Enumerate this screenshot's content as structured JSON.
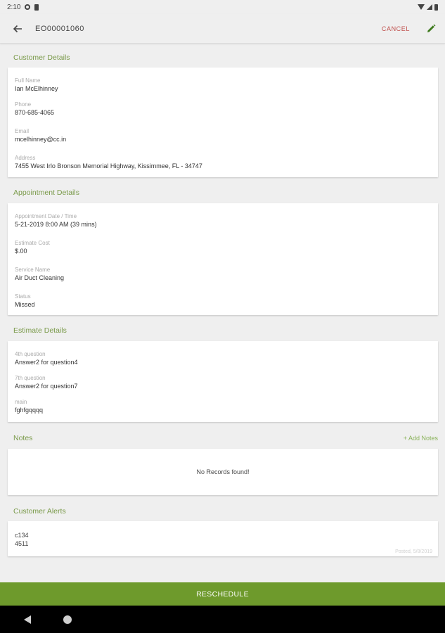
{
  "status_bar": {
    "time": "2:10"
  },
  "app_bar": {
    "title": "EO00001060",
    "cancel_label": "CANCEL"
  },
  "customer_details": {
    "title": "Customer Details",
    "fields": [
      {
        "label": "Full Name",
        "value": "Ian McElhinney"
      },
      {
        "label": "Phone",
        "value": "870-685-4065"
      },
      {
        "label": "Email",
        "value": "mcelhinney@cc.in"
      },
      {
        "label": "Address",
        "value": "7455 West Irlo Bronson Memorial Highway, Kissimmee, FL - 34747"
      }
    ]
  },
  "appointment_details": {
    "title": "Appointment Details",
    "fields": [
      {
        "label": "Appointment Date / Time",
        "value": "5-21-2019 8:00 AM  (39 mins)"
      },
      {
        "label": "Estimate Cost",
        "value": "$.00"
      },
      {
        "label": "Service Name",
        "value": "Air Duct Cleaning"
      },
      {
        "label": "Status",
        "value": "Missed"
      }
    ]
  },
  "estimate_details": {
    "title": "Estimate Details",
    "fields": [
      {
        "label": "4th question",
        "value": "Answer2 for question4"
      },
      {
        "label": "7th question",
        "value": "Answer2 for question7"
      },
      {
        "label": "main",
        "value": "fghfgqqqq"
      }
    ]
  },
  "notes": {
    "title": "Notes",
    "add_label": "+ Add Notes",
    "empty_text": "No Records found!"
  },
  "customer_alerts": {
    "title": "Customer Alerts",
    "lines": [
      "c134",
      "4511"
    ],
    "posted": "Posted, 5/8/2019"
  },
  "bottom_button": {
    "label": "RESCHEDULE"
  },
  "colors": {
    "accent": "#6e9a2c",
    "section_title": "#7a9a4a",
    "cancel": "#c0504d"
  }
}
